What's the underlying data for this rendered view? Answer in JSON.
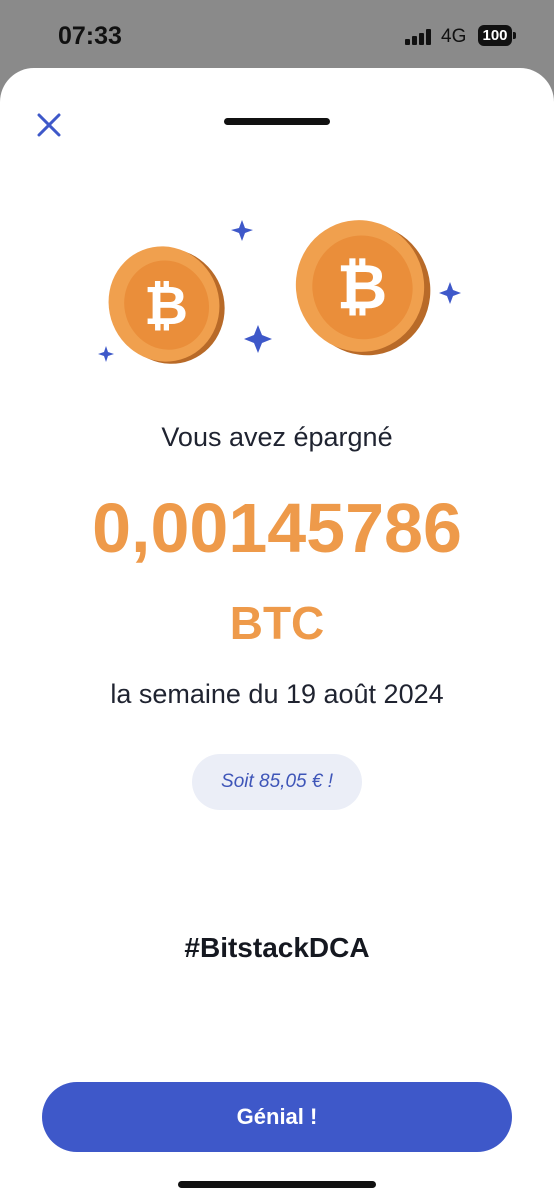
{
  "status_bar": {
    "time": "07:33",
    "network": "4G",
    "battery": "100"
  },
  "summary": {
    "saved_label": "Vous avez épargné",
    "amount": "0,00145786",
    "unit": "BTC",
    "week": "la semaine du 19 août 2024",
    "equivalent": "Soit 85,05 € !",
    "hashtag": "#BitstackDCA"
  },
  "actions": {
    "confirm_label": "Génial !"
  },
  "colors": {
    "accent_orange": "#EE9A4A",
    "primary_blue": "#3E58C9",
    "pill_bg": "#EBEEF7"
  },
  "icons": [
    "close-icon",
    "bitcoin-coin-icon",
    "sparkle-icon",
    "signal-icon",
    "battery-icon"
  ]
}
